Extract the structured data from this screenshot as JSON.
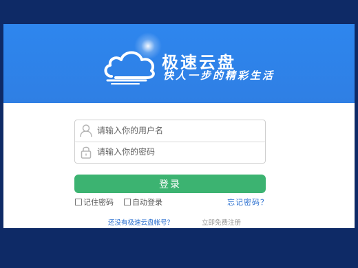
{
  "brand": {
    "title": "极速云盘",
    "slogan": "快人一步的精彩生活"
  },
  "login_form": {
    "username_placeholder": "请输入你的用户名",
    "password_placeholder": "请输入你的密码",
    "submit_label": "登录"
  },
  "options": {
    "remember_password": "记住密码",
    "auto_login": "自动登录",
    "forgot_password": "忘记密码？"
  },
  "footer": {
    "no_account": "还没有极速云盘帐号？",
    "register": "立即免费注册"
  },
  "colors": {
    "background": "#0e2a66",
    "banner": "#2f7fe4",
    "login_button": "#3cb371",
    "link": "#2a6fd0"
  },
  "icons": {
    "logo": "cloud-icon",
    "username": "user-icon",
    "password": "lock-icon"
  }
}
